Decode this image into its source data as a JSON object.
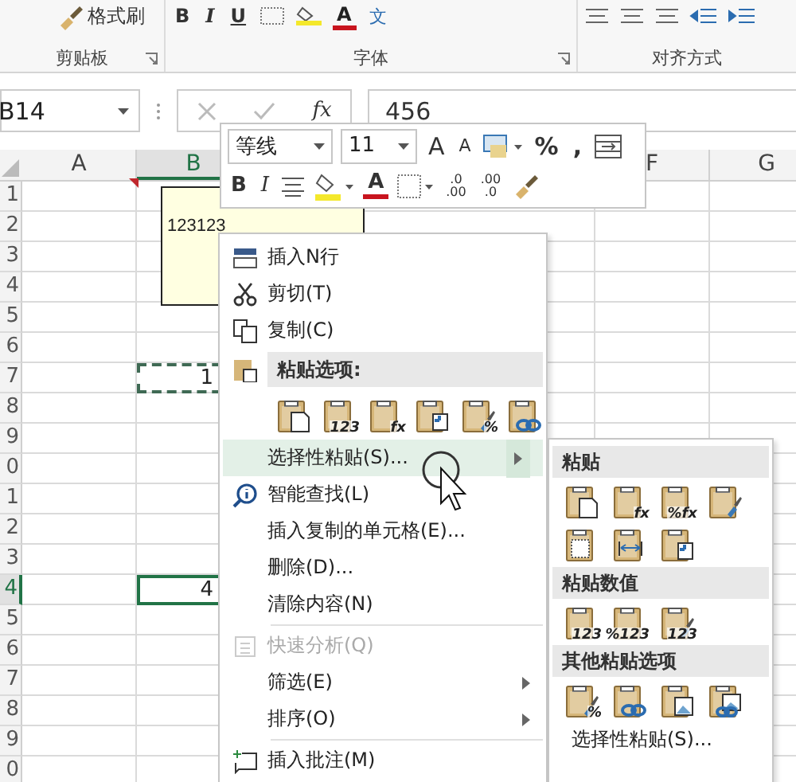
{
  "ribbon": {
    "font_buttons": [
      "B",
      "I",
      "U"
    ],
    "font_color": "A",
    "phonetic": "文",
    "format_painter": "格式刷",
    "groups": [
      "剪贴板",
      "字体",
      "对齐方式"
    ]
  },
  "formula_bar": {
    "name_box": "B14",
    "fx": "fx",
    "value": "456"
  },
  "columns": [
    {
      "label": "A",
      "selected": false
    },
    {
      "label": "B",
      "selected": true
    },
    {
      "label": "F",
      "selected": false
    },
    {
      "label": "G",
      "selected": false
    }
  ],
  "rows": [
    {
      "label": "1",
      "selected": false
    },
    {
      "label": "2",
      "selected": false
    },
    {
      "label": "3",
      "selected": false
    },
    {
      "label": "4",
      "selected": false
    },
    {
      "label": "5",
      "selected": false
    },
    {
      "label": "6",
      "selected": false
    },
    {
      "label": "7",
      "selected": false,
      "cell_b": {
        "text": "1",
        "kind": "copied"
      }
    },
    {
      "label": "8",
      "selected": false
    },
    {
      "label": "9",
      "selected": false
    },
    {
      "label": "0",
      "selected": false
    },
    {
      "label": "1",
      "selected": false
    },
    {
      "label": "2",
      "selected": false
    },
    {
      "label": "3",
      "selected": false
    },
    {
      "label": "4",
      "selected": true,
      "cell_b": {
        "text": "4",
        "kind": "active"
      }
    },
    {
      "label": "5",
      "selected": false
    },
    {
      "label": "6",
      "selected": false
    },
    {
      "label": "7",
      "selected": false
    },
    {
      "label": "8",
      "selected": false
    },
    {
      "label": "9",
      "selected": false
    },
    {
      "label": "0",
      "selected": false
    }
  ],
  "comment": {
    "text": "123123"
  },
  "mini_toolbar": {
    "font": "等线",
    "size": "11",
    "grow_font": "A",
    "shrink_font": "A",
    "percent": "%",
    "comma": ",",
    "bold": "B",
    "italic": "I",
    "font_color": "A",
    "increase_decimal": [
      ".0",
      ".00"
    ],
    "decrease_decimal": [
      ".00",
      ".0"
    ]
  },
  "context_menu": [
    {
      "kind": "item",
      "label": "插入N行",
      "submenu": false,
      "disabled": false,
      "selected": false
    },
    {
      "kind": "item",
      "label": "剪切(T)",
      "submenu": false,
      "disabled": false,
      "selected": false
    },
    {
      "kind": "item",
      "label": "复制(C)",
      "submenu": false,
      "disabled": false,
      "selected": false
    },
    {
      "kind": "header",
      "label": "粘贴选项:"
    },
    {
      "kind": "icons",
      "icons": [
        {
          "kind": "plain"
        },
        {
          "kind": "values",
          "label": "123"
        },
        {
          "kind": "formula",
          "label": "fx"
        },
        {
          "kind": "transpose"
        },
        {
          "kind": "format",
          "label": "%"
        },
        {
          "kind": "link"
        }
      ]
    },
    {
      "kind": "item",
      "label": "选择性粘贴(S)...",
      "submenu": true,
      "disabled": false,
      "selected": true
    },
    {
      "kind": "item",
      "label": "智能查找(L)",
      "submenu": false,
      "disabled": false,
      "selected": false
    },
    {
      "kind": "item",
      "label": "插入复制的单元格(E)...",
      "submenu": false,
      "disabled": false,
      "selected": false
    },
    {
      "kind": "item",
      "label": "删除(D)...",
      "submenu": false,
      "disabled": false,
      "selected": false
    },
    {
      "kind": "item",
      "label": "清除内容(N)",
      "submenu": false,
      "disabled": false,
      "selected": false
    },
    {
      "kind": "separator"
    },
    {
      "kind": "item",
      "label": "快速分析(Q)",
      "submenu": false,
      "disabled": true,
      "selected": false
    },
    {
      "kind": "item",
      "label": "筛选(E)",
      "submenu": true,
      "disabled": false,
      "selected": false
    },
    {
      "kind": "item",
      "label": "排序(O)",
      "submenu": true,
      "disabled": false,
      "selected": false
    },
    {
      "kind": "separator"
    },
    {
      "kind": "item",
      "label": "插入批注(M)",
      "submenu": false,
      "disabled": false,
      "selected": false
    }
  ],
  "paste_submenu": [
    {
      "kind": "header",
      "label": "粘贴"
    },
    {
      "kind": "icons",
      "icons": [
        {
          "kind": "plain"
        },
        {
          "kind": "formula",
          "label": "fx"
        },
        {
          "kind": "formula",
          "label": "%fx"
        },
        {
          "kind": "format"
        }
      ]
    },
    {
      "kind": "icons",
      "icons": [
        {
          "kind": "no-borders"
        },
        {
          "kind": "column-widths"
        },
        {
          "kind": "transpose"
        }
      ]
    },
    {
      "kind": "header",
      "label": "粘贴数值"
    },
    {
      "kind": "icons",
      "icons": [
        {
          "kind": "values",
          "label": "123"
        },
        {
          "kind": "values",
          "label": "%123"
        },
        {
          "kind": "format",
          "label": "123"
        }
      ]
    },
    {
      "kind": "header",
      "label": "其他粘贴选项"
    },
    {
      "kind": "icons",
      "icons": [
        {
          "kind": "format",
          "label": "%"
        },
        {
          "kind": "link"
        },
        {
          "kind": "picture"
        },
        {
          "kind": "linked-picture"
        }
      ]
    },
    {
      "kind": "item",
      "label": "选择性粘贴(S)...",
      "submenu": false,
      "disabled": false,
      "selected": false
    }
  ]
}
